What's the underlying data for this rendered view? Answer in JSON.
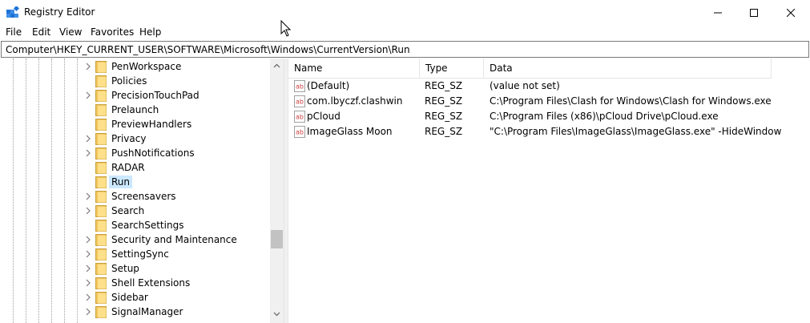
{
  "window": {
    "title": "Registry Editor"
  },
  "menu": [
    "File",
    "Edit",
    "View",
    "Favorites",
    "Help"
  ],
  "address": {
    "path": "Computer\\HKEY_CURRENT_USER\\SOFTWARE\\Microsoft\\Windows\\CurrentVersion\\Run"
  },
  "tree": {
    "items": [
      {
        "label": "PenWorkspace",
        "expandable": true
      },
      {
        "label": "Policies",
        "expandable": false
      },
      {
        "label": "PrecisionTouchPad",
        "expandable": true
      },
      {
        "label": "Prelaunch",
        "expandable": false
      },
      {
        "label": "PreviewHandlers",
        "expandable": false
      },
      {
        "label": "Privacy",
        "expandable": true
      },
      {
        "label": "PushNotifications",
        "expandable": true
      },
      {
        "label": "RADAR",
        "expandable": false
      },
      {
        "label": "Run",
        "expandable": false,
        "selected": true
      },
      {
        "label": "Screensavers",
        "expandable": true
      },
      {
        "label": "Search",
        "expandable": true
      },
      {
        "label": "SearchSettings",
        "expandable": false
      },
      {
        "label": "Security and Maintenance",
        "expandable": true
      },
      {
        "label": "SettingSync",
        "expandable": true
      },
      {
        "label": "Setup",
        "expandable": true
      },
      {
        "label": "Shell Extensions",
        "expandable": true
      },
      {
        "label": "Sidebar",
        "expandable": true
      },
      {
        "label": "SignalManager",
        "expandable": true
      }
    ]
  },
  "list": {
    "columns": {
      "name": "Name",
      "type": "Type",
      "data": "Data"
    },
    "rows": [
      {
        "name": "(Default)",
        "type": "REG_SZ",
        "data": "(value not set)"
      },
      {
        "name": "com.lbyczf.clashwin",
        "type": "REG_SZ",
        "data": "C:\\Program Files\\Clash for Windows\\Clash for Windows.exe"
      },
      {
        "name": "pCloud",
        "type": "REG_SZ",
        "data": "C:\\Program Files (x86)\\pCloud Drive\\pCloud.exe"
      },
      {
        "name": "ImageGlass Moon",
        "type": "REG_SZ",
        "data": "\"C:\\Program Files\\ImageGlass\\ImageGlass.exe\" -HideWindow"
      }
    ]
  },
  "icons": {
    "app": "registry-icon",
    "folder": "folder-icon",
    "value": "string-value-icon",
    "chevron": "chevron-right-icon"
  },
  "colors": {
    "selection": "#cce8ff",
    "folder": "#f2c55c",
    "value_icon": "#d23b3b"
  }
}
